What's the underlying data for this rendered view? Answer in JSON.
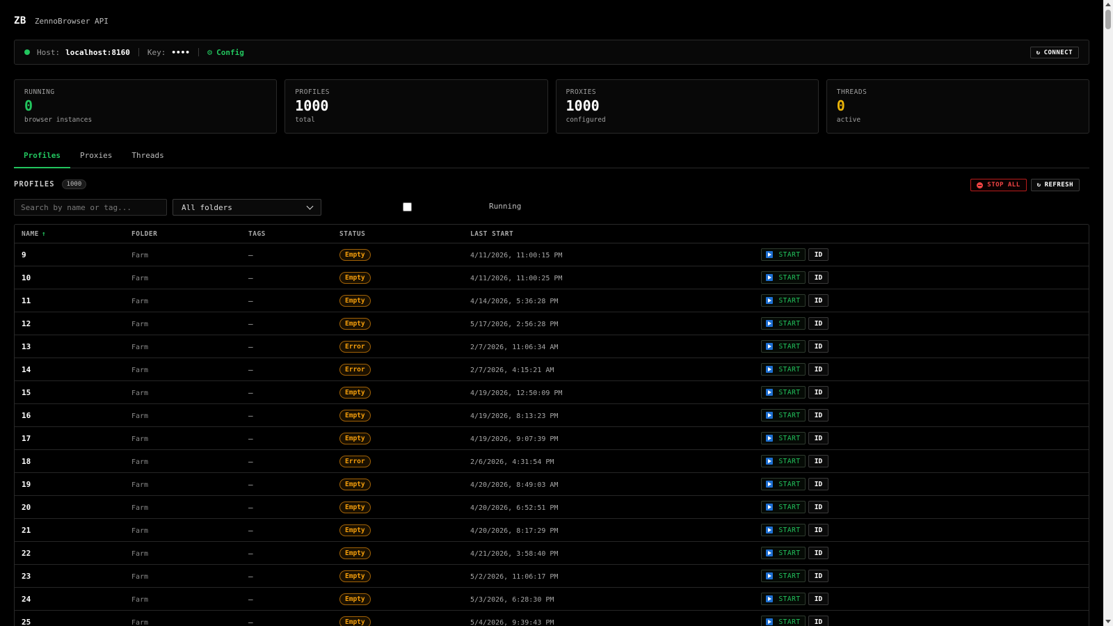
{
  "header": {
    "logo": "ZB",
    "title": "ZennoBrowser API"
  },
  "connection": {
    "host_label": "Host:",
    "host_value": "localhost:8160",
    "key_label": "Key:",
    "key_value": "••••",
    "config_label": "Config",
    "connect_label": "CONNECT",
    "status_color": "#22c55e"
  },
  "stats": [
    {
      "label": "RUNNING",
      "value": "0",
      "sub": "browser instances",
      "color": "#22c55e"
    },
    {
      "label": "PROFILES",
      "value": "1000",
      "sub": "total",
      "color": "#ffffff"
    },
    {
      "label": "PROXIES",
      "value": "1000",
      "sub": "configured",
      "color": "#ffffff"
    },
    {
      "label": "THREADS",
      "value": "0",
      "sub": "active",
      "color": "#eab308"
    }
  ],
  "tabs": [
    {
      "label": "Profiles",
      "active": true
    },
    {
      "label": "Proxies",
      "active": false
    },
    {
      "label": "Threads",
      "active": false
    }
  ],
  "profiles_section": {
    "title": "PROFILES",
    "count": "1000",
    "stop_all_label": "STOP ALL",
    "refresh_label": "REFRESH",
    "search_placeholder": "Search by name or tag...",
    "folder_selected": "All folders",
    "running_label": "Running"
  },
  "table": {
    "headers": {
      "name": "NAME",
      "folder": "FOLDER",
      "tags": "TAGS",
      "status": "STATUS",
      "last_start": "LAST START"
    },
    "start_label": "START",
    "id_label": "ID",
    "rows": [
      {
        "name": "9",
        "folder": "Farm",
        "tags": "—",
        "status": "Empty",
        "last_start": "4/11/2026, 11:00:15 PM"
      },
      {
        "name": "10",
        "folder": "Farm",
        "tags": "—",
        "status": "Empty",
        "last_start": "4/11/2026, 11:00:25 PM"
      },
      {
        "name": "11",
        "folder": "Farm",
        "tags": "—",
        "status": "Empty",
        "last_start": "4/14/2026, 5:36:28 PM"
      },
      {
        "name": "12",
        "folder": "Farm",
        "tags": "—",
        "status": "Empty",
        "last_start": "5/17/2026, 2:56:28 PM"
      },
      {
        "name": "13",
        "folder": "Farm",
        "tags": "—",
        "status": "Error",
        "last_start": "2/7/2026, 11:06:34 AM"
      },
      {
        "name": "14",
        "folder": "Farm",
        "tags": "—",
        "status": "Error",
        "last_start": "2/7/2026, 4:15:21 AM"
      },
      {
        "name": "15",
        "folder": "Farm",
        "tags": "—",
        "status": "Empty",
        "last_start": "4/19/2026, 12:50:09 PM"
      },
      {
        "name": "16",
        "folder": "Farm",
        "tags": "—",
        "status": "Empty",
        "last_start": "4/19/2026, 8:13:23 PM"
      },
      {
        "name": "17",
        "folder": "Farm",
        "tags": "—",
        "status": "Empty",
        "last_start": "4/19/2026, 9:07:39 PM"
      },
      {
        "name": "18",
        "folder": "Farm",
        "tags": "—",
        "status": "Error",
        "last_start": "2/6/2026, 4:31:54 PM"
      },
      {
        "name": "19",
        "folder": "Farm",
        "tags": "—",
        "status": "Empty",
        "last_start": "4/20/2026, 8:49:03 AM"
      },
      {
        "name": "20",
        "folder": "Farm",
        "tags": "—",
        "status": "Empty",
        "last_start": "4/20/2026, 6:52:51 PM"
      },
      {
        "name": "21",
        "folder": "Farm",
        "tags": "—",
        "status": "Empty",
        "last_start": "4/20/2026, 8:17:29 PM"
      },
      {
        "name": "22",
        "folder": "Farm",
        "tags": "—",
        "status": "Empty",
        "last_start": "4/21/2026, 3:58:40 PM"
      },
      {
        "name": "23",
        "folder": "Farm",
        "tags": "—",
        "status": "Empty",
        "last_start": "5/2/2026, 11:06:17 PM"
      },
      {
        "name": "24",
        "folder": "Farm",
        "tags": "—",
        "status": "Empty",
        "last_start": "5/3/2026, 6:28:30 PM"
      },
      {
        "name": "25",
        "folder": "Farm",
        "tags": "—",
        "status": "Empty",
        "last_start": "5/4/2026, 9:39:43 PM"
      }
    ]
  }
}
